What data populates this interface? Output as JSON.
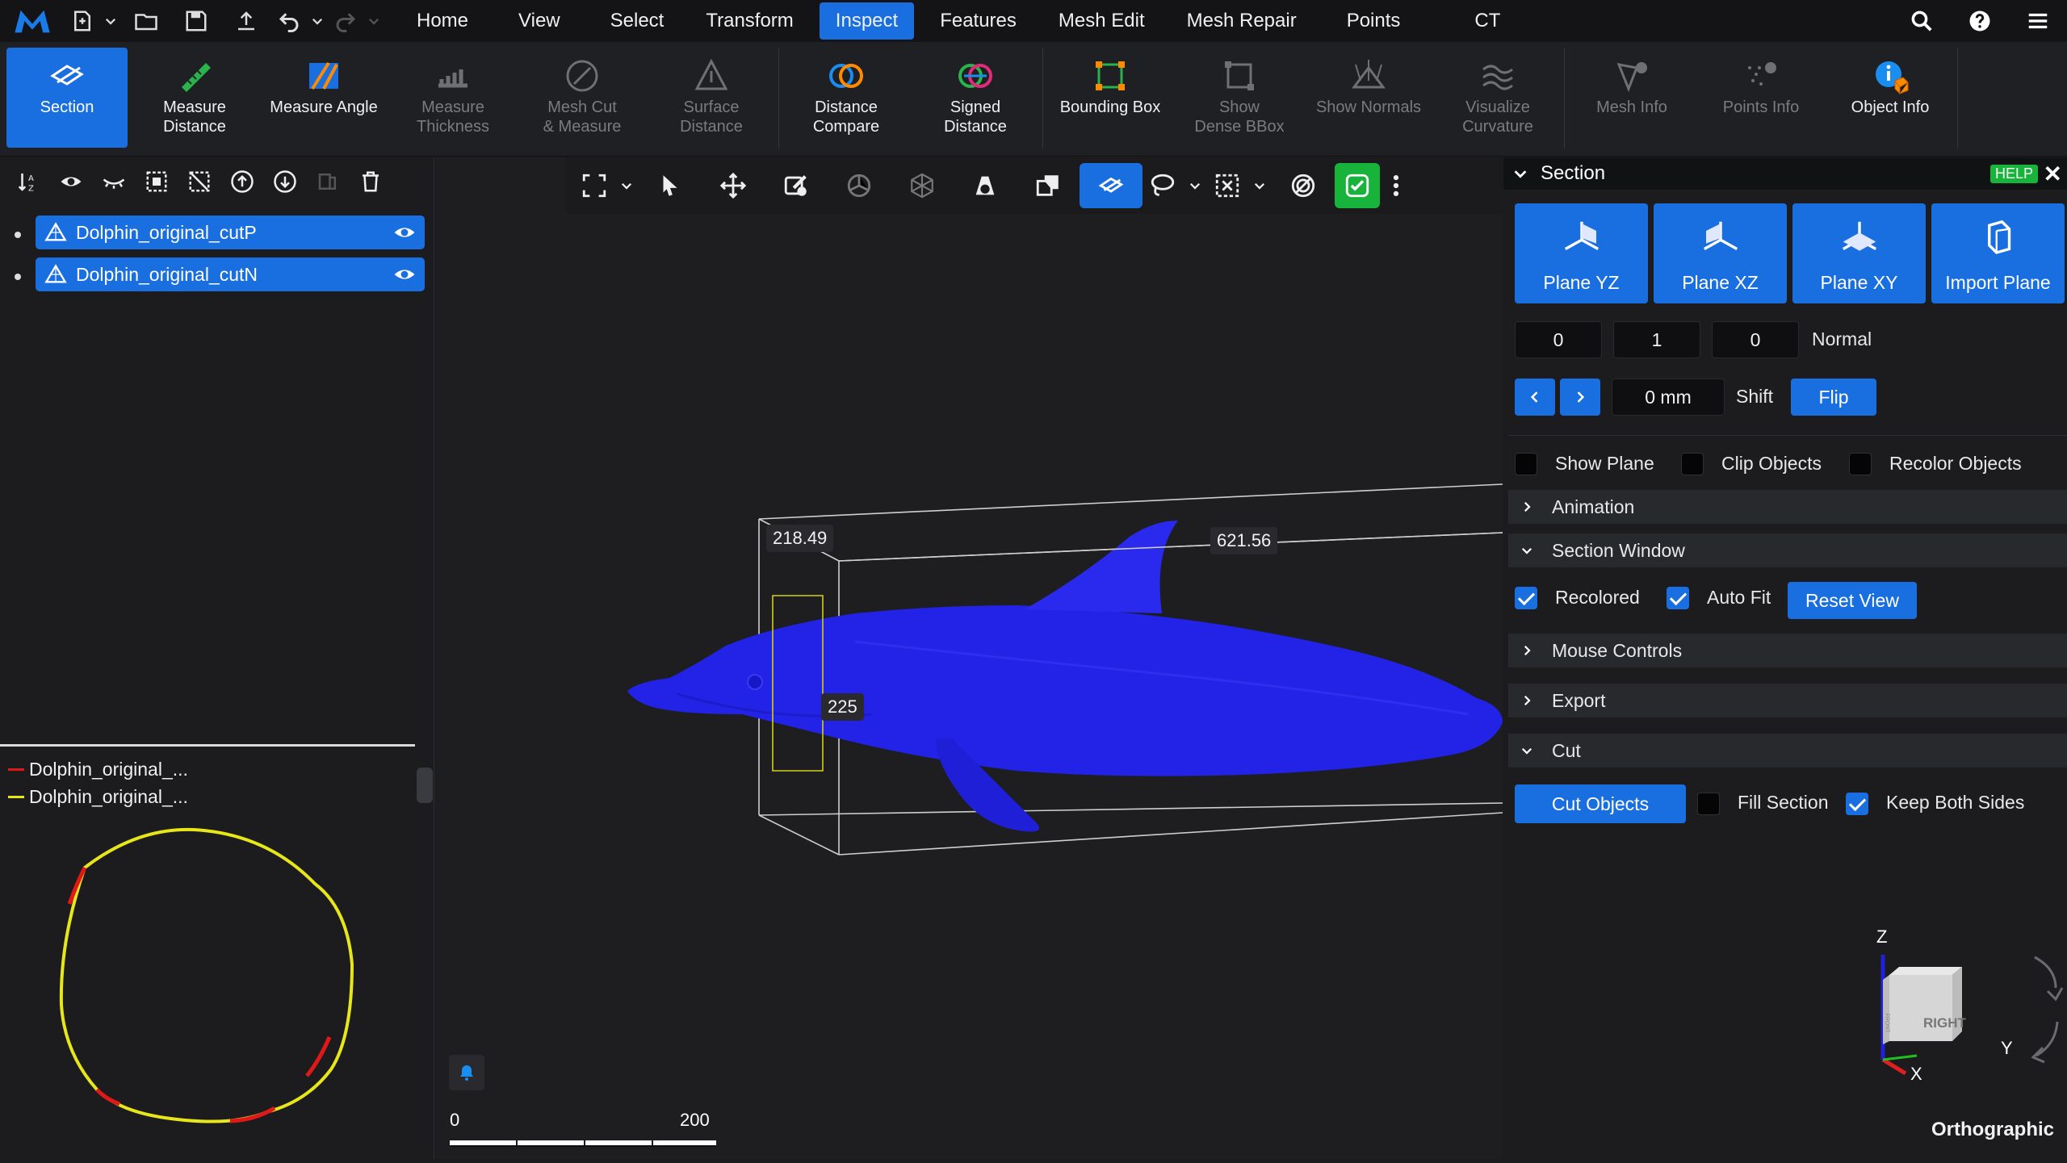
{
  "menu": {
    "tabs": [
      "Home",
      "View",
      "Select",
      "Transform",
      "Inspect",
      "Features",
      "Mesh Edit",
      "Mesh Repair",
      "Points",
      "CT"
    ],
    "active_tab": "Inspect"
  },
  "ribbon": {
    "section": "Section",
    "measure_distance": "Measure\nDistance",
    "measure_angle": "Measure Angle",
    "measure_thickness": "Measure\nThickness",
    "mesh_cut_measure": "Mesh Cut\n& Measure",
    "surface_distance": "Surface\nDistance",
    "distance_compare": "Distance\nCompare",
    "signed_distance": "Signed\nDistance",
    "bounding_box": "Bounding Box",
    "show_dense_bbox": "Show\nDense BBox",
    "show_normals": "Show Normals",
    "visualize_curvature": "Visualize\nCurvature",
    "mesh_info": "Mesh Info",
    "points_info": "Points Info",
    "object_info": "Object Info"
  },
  "scene": {
    "objects": [
      {
        "name": "Dolphin_original_cutP"
      },
      {
        "name": "Dolphin_original_cutN"
      }
    ]
  },
  "section_view": {
    "legend": [
      {
        "name": "Dolphin_original_...",
        "color": "#e01818"
      },
      {
        "name": "Dolphin_original_...",
        "color": "#e6e619"
      }
    ]
  },
  "viewport": {
    "dims": {
      "height": "218.49",
      "length": "621.56",
      "width": "225"
    },
    "scale_start": "0",
    "scale_end": "200",
    "projection": "Orthographic",
    "axes": {
      "z": "Z",
      "y": "Y",
      "x": "X"
    },
    "cube_face": "RIGHT",
    "cube_side": "FRONT"
  },
  "panel": {
    "title": "Section",
    "help": "HELP",
    "planes": [
      "Plane YZ",
      "Plane XZ",
      "Plane XY",
      "Import Plane"
    ],
    "normal": {
      "x": "0",
      "y": "1",
      "z": "0",
      "label": "Normal"
    },
    "shift": {
      "value": "0 mm",
      "label": "Shift",
      "flip": "Flip"
    },
    "show_plane": "Show Plane",
    "clip_objects": "Clip Objects",
    "recolor_objects": "Recolor Objects",
    "animation": "Animation",
    "section_window": "Section Window",
    "recolored": "Recolored",
    "auto_fit": "Auto Fit",
    "reset_view": "Reset View",
    "mouse_controls": "Mouse Controls",
    "export": "Export",
    "cut": "Cut",
    "cut_objects": "Cut Objects",
    "fill_section": "Fill Section",
    "keep_both_sides": "Keep Both Sides"
  },
  "colors": {
    "accent": "#1a6fe0",
    "dolphin": "#2323e8",
    "green": "#18b33a"
  }
}
